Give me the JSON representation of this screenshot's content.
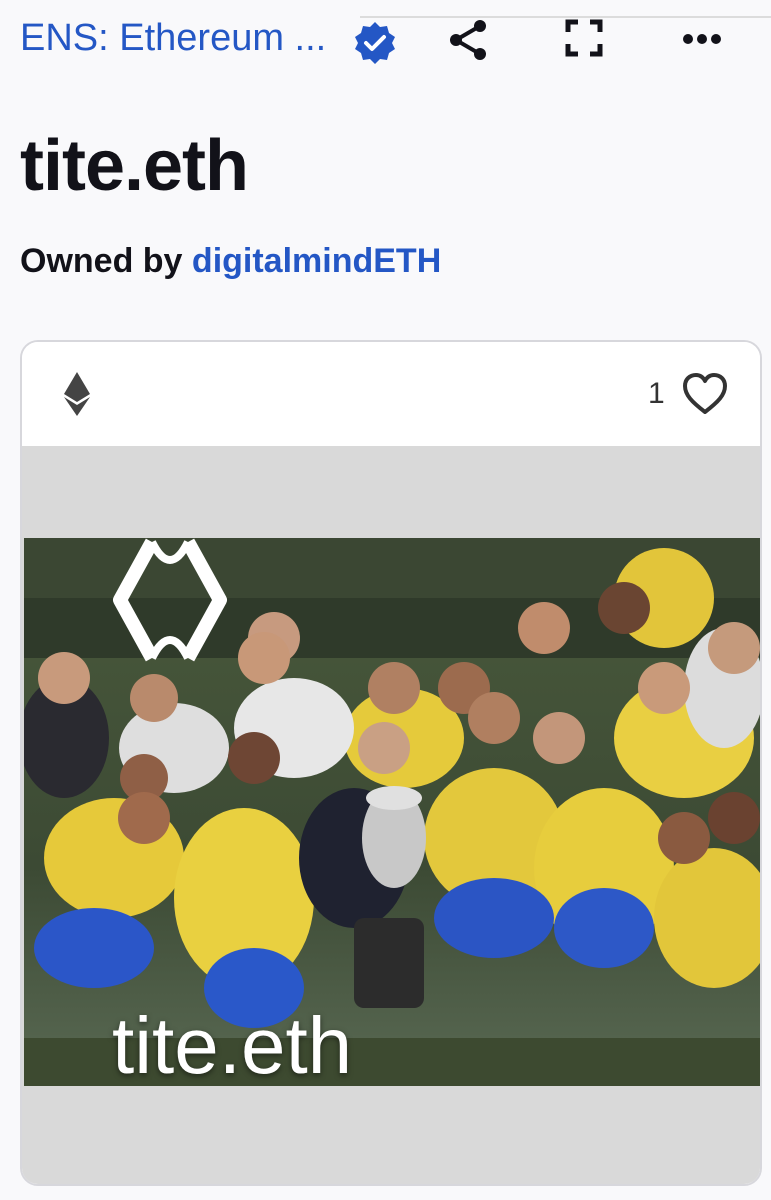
{
  "header": {
    "collection_name": "ENS: Ethereum ...",
    "icons": [
      "verified-badge-icon",
      "share-icon",
      "fullscreen-icon",
      "more-icon"
    ]
  },
  "item": {
    "title": "tite.eth",
    "owned_by_label": "Owned by",
    "owner": "digitalmindETH"
  },
  "card": {
    "chain_icon": "ethereum-icon",
    "like_count": "1",
    "image_caption": "tite.eth"
  },
  "colors": {
    "accent": "#2457c5",
    "text": "#121219",
    "background": "#f9f9fb"
  }
}
